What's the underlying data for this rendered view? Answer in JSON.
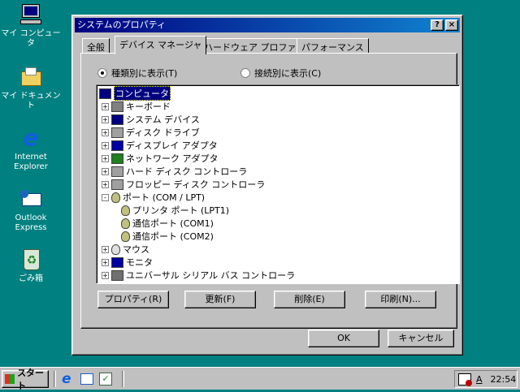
{
  "desktop": {
    "icons": [
      {
        "label": "マイ コンピュータ"
      },
      {
        "label": "マイ ドキュメント"
      },
      {
        "label": "Internet Explorer"
      },
      {
        "label": "Outlook Express"
      },
      {
        "label": "ごみ箱"
      }
    ]
  },
  "dialog": {
    "title": "システムのプロパティ",
    "help": "?",
    "close": "×",
    "tabs": [
      {
        "label": "全般"
      },
      {
        "label": "デバイス マネージャ"
      },
      {
        "label": "ハードウェア プロファイル"
      },
      {
        "label": "パフォーマンス"
      }
    ],
    "radios": [
      {
        "label": "種類別に表示(T)",
        "checked": true
      },
      {
        "label": "接続別に表示(C)",
        "checked": false
      }
    ],
    "tree": [
      {
        "label": "コンピュータ",
        "level": 0,
        "icon": "computer-icon"
      },
      {
        "label": "キーボード",
        "level": 1,
        "exp": "+",
        "icon": "keyboard-icon"
      },
      {
        "label": "システム デバイス",
        "level": 1,
        "exp": "+",
        "icon": "computer-icon"
      },
      {
        "label": "ディスク ドライブ",
        "level": 1,
        "exp": "+",
        "icon": "disk-icon"
      },
      {
        "label": "ディスプレイ アダプタ",
        "level": 1,
        "exp": "+",
        "icon": "monitor-icon"
      },
      {
        "label": "ネットワーク アダプタ",
        "level": 1,
        "exp": "+",
        "icon": "network-icon"
      },
      {
        "label": "ハード ディスク コントローラ",
        "level": 1,
        "exp": "+",
        "icon": "controller-icon"
      },
      {
        "label": "フロッピー ディスク コントローラ",
        "level": 1,
        "exp": "+",
        "icon": "controller-icon"
      },
      {
        "label": "ポート (COM / LPT)",
        "level": 1,
        "exp": "−",
        "icon": "port-icon"
      },
      {
        "label": "プリンタ ポート (LPT1)",
        "level": 2,
        "icon": "port-icon"
      },
      {
        "label": "通信ポート (COM1)",
        "level": 2,
        "icon": "port-icon"
      },
      {
        "label": "通信ポート (COM2)",
        "level": 2,
        "icon": "port-icon"
      },
      {
        "label": "マウス",
        "level": 1,
        "exp": "+",
        "icon": "mouse-icon"
      },
      {
        "label": "モニタ",
        "level": 1,
        "exp": "+",
        "icon": "monitor-icon"
      },
      {
        "label": "ユニバーサル シリアル バス コントローラ",
        "level": 1,
        "exp": "+",
        "icon": "usb-icon"
      }
    ],
    "buttons": {
      "properties": "プロパティ(R)",
      "refresh": "更新(F)",
      "remove": "削除(E)",
      "print": "印刷(N)..."
    },
    "ok": "OK",
    "cancel": "キャンセル"
  },
  "taskbar": {
    "start": "スタート",
    "ime": "A",
    "clock": "22:54"
  }
}
